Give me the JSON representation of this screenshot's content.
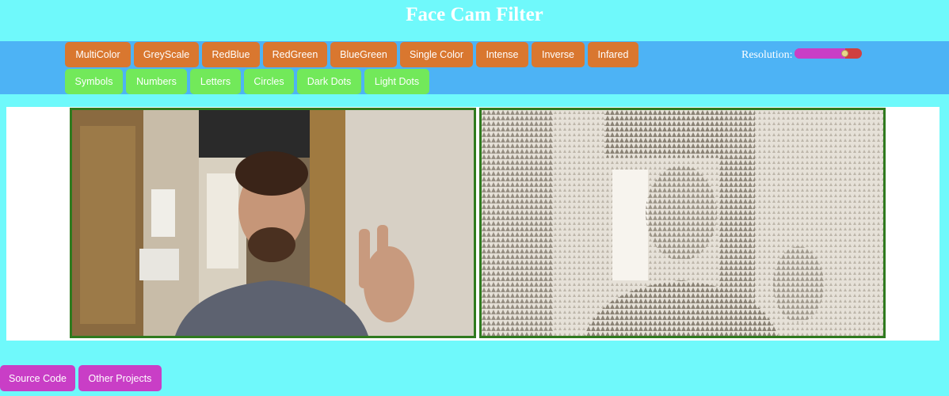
{
  "header": {
    "title": "Face Cam Filter"
  },
  "toolbar": {
    "color_filters": [
      {
        "label": "MultiColor",
        "name": "multicolor"
      },
      {
        "label": "GreyScale",
        "name": "greyscale"
      },
      {
        "label": "RedBlue",
        "name": "redblue"
      },
      {
        "label": "RedGreen",
        "name": "redgreen"
      },
      {
        "label": "BlueGreen",
        "name": "bluegreen"
      },
      {
        "label": "Single Color",
        "name": "single-color"
      },
      {
        "label": "Intense",
        "name": "intense"
      },
      {
        "label": "Inverse",
        "name": "inverse"
      },
      {
        "label": "Infared",
        "name": "infared"
      }
    ],
    "render_modes": [
      {
        "label": "Symbols",
        "name": "symbols"
      },
      {
        "label": "Numbers",
        "name": "numbers"
      },
      {
        "label": "Letters",
        "name": "letters"
      },
      {
        "label": "Circles",
        "name": "circles"
      },
      {
        "label": "Dark Dots",
        "name": "dark-dots"
      },
      {
        "label": "Light Dots",
        "name": "light-dots"
      }
    ],
    "resolution": {
      "label": "Resolution:",
      "value_fraction": 0.75
    }
  },
  "colors": {
    "background": "#6ff9fb",
    "toolbar": "#4db3f5",
    "color_filter_button": "#d9772f",
    "render_mode_button": "#72e95a",
    "footer_button": "#c93ec6",
    "video_border": "#2f7a1e"
  },
  "footer": {
    "source_code_label": "Source Code",
    "other_projects_label": "Other Projects"
  }
}
